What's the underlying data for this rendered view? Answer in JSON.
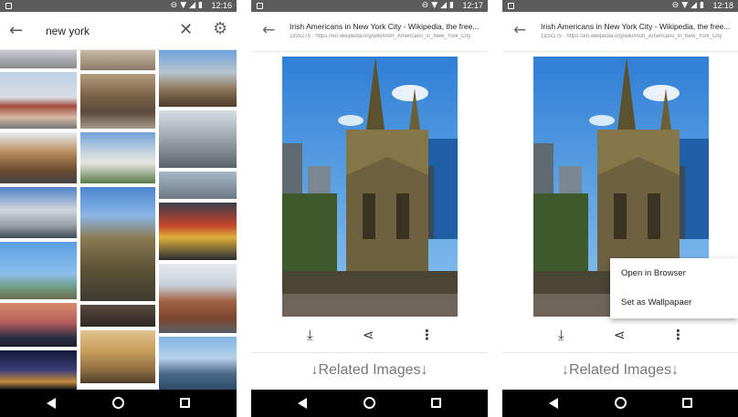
{
  "status": {
    "p1_time": "12:16",
    "p2_time": "12:17",
    "p3_time": "12:18"
  },
  "search": {
    "query": "new york",
    "back_icon": "arrow-left-icon",
    "clear_icon": "close-icon",
    "settings_icon": "gear-icon"
  },
  "detail": {
    "title": "Irish Americans in New York City - Wikipedia, the free...",
    "subtitle": "183x275 · https://en.wikipedia.org/wiki/Irish_Americans_in_New_York_City",
    "related_label": "↓Related Images↓"
  },
  "menu": {
    "items": [
      "Open in Browser",
      "Set as Wallpapaer"
    ]
  },
  "actions": [
    "download-icon",
    "share-icon",
    "more-vert-icon"
  ]
}
